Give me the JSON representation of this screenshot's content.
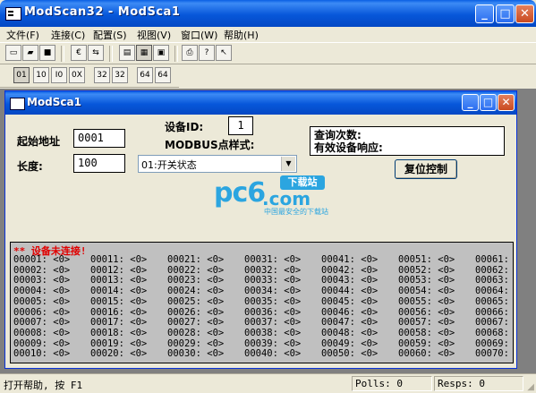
{
  "window": {
    "title": "ModScan32 - ModSca1"
  },
  "menu": [
    "文件(F)",
    "连接(C)",
    "配置(S)",
    "视图(V)",
    "窗口(W)",
    "帮助(H)"
  ],
  "toolbar_row2_labels": [
    "01",
    "10",
    "I0",
    "0X",
    "32",
    "32",
    "64",
    "64"
  ],
  "child": {
    "title": "ModSca1",
    "device_id_label": "设备ID:",
    "device_id_value": "1",
    "modbus_label": "MODBUS点样式:",
    "start_addr_label": "起始地址",
    "start_addr_value": "0001",
    "length_label": "长度:",
    "length_value": "100",
    "point_type_value": "01:开关状态",
    "poll_label": "查询次数:",
    "resp_label": "有效设备响应:",
    "reset_button": "复位控制"
  },
  "logo": {
    "pc": "pc6",
    "com": ".com",
    "badge": "下载站",
    "sub": "中国最安全的下载站"
  },
  "data": {
    "error": "** 设备未连接!",
    "rows": 10,
    "cols": 7,
    "value": "<0>"
  },
  "status": {
    "help": "打开帮助, 按 F1",
    "polls": "Polls: 0",
    "resps": "Resps: 0"
  },
  "colors": {
    "titlebar": "#0757da",
    "data_bg": "#c0c0c0",
    "error": "#e00000",
    "logo": "#2ba5e0"
  }
}
